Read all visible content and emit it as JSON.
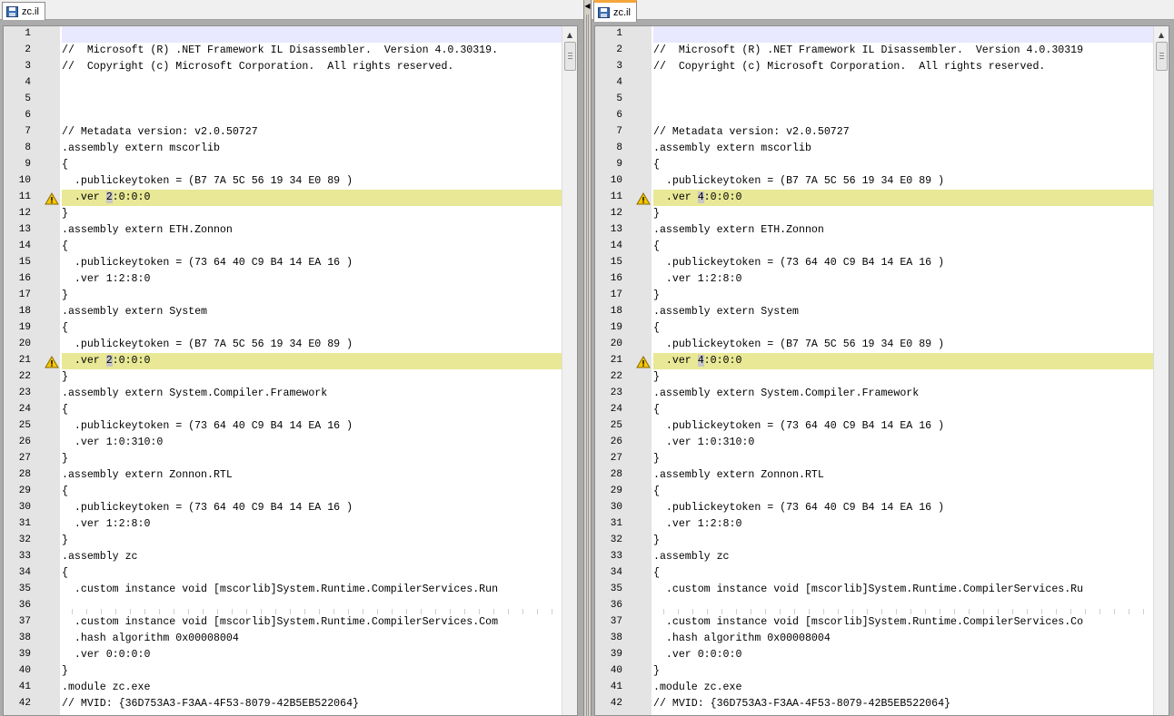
{
  "left": {
    "tab_label": "zc.il",
    "tab_icon": "save-disk-icon",
    "diff_char": "2",
    "lines": [
      {
        "n": "1",
        "text": "",
        "type": "current"
      },
      {
        "n": "2",
        "text": "//  Microsoft (R) .NET Framework IL Disassembler.  Version 4.0.30319.",
        "type": "normal"
      },
      {
        "n": "3",
        "text": "//  Copyright (c) Microsoft Corporation.  All rights reserved.",
        "type": "normal"
      },
      {
        "n": "4",
        "text": "",
        "type": "normal"
      },
      {
        "n": "5",
        "text": "",
        "type": "normal"
      },
      {
        "n": "6",
        "text": "",
        "type": "normal"
      },
      {
        "n": "7",
        "text": "// Metadata version: v2.0.50727",
        "type": "normal"
      },
      {
        "n": "8",
        "text": ".assembly extern mscorlib",
        "type": "normal"
      },
      {
        "n": "9",
        "text": "{",
        "type": "normal"
      },
      {
        "n": "10",
        "text": "  .publickeytoken = (B7 7A 5C 56 19 34 E0 89 )",
        "type": "normal"
      },
      {
        "n": "11",
        "pre": "  .ver ",
        "post": ":0:0:0",
        "type": "diff"
      },
      {
        "n": "12",
        "text": "}",
        "type": "normal"
      },
      {
        "n": "13",
        "text": ".assembly extern ETH.Zonnon",
        "type": "normal"
      },
      {
        "n": "14",
        "text": "{",
        "type": "normal"
      },
      {
        "n": "15",
        "text": "  .publickeytoken = (73 64 40 C9 B4 14 EA 16 )",
        "type": "normal"
      },
      {
        "n": "16",
        "text": "  .ver 1:2:8:0",
        "type": "normal"
      },
      {
        "n": "17",
        "text": "}",
        "type": "normal"
      },
      {
        "n": "18",
        "text": ".assembly extern System",
        "type": "normal"
      },
      {
        "n": "19",
        "text": "{",
        "type": "normal"
      },
      {
        "n": "20",
        "text": "  .publickeytoken = (B7 7A 5C 56 19 34 E0 89 )",
        "type": "normal"
      },
      {
        "n": "21",
        "pre": "  .ver ",
        "post": ":0:0:0",
        "type": "diff"
      },
      {
        "n": "22",
        "text": "}",
        "type": "normal"
      },
      {
        "n": "23",
        "text": ".assembly extern System.Compiler.Framework",
        "type": "normal"
      },
      {
        "n": "24",
        "text": "{",
        "type": "normal"
      },
      {
        "n": "25",
        "text": "  .publickeytoken = (73 64 40 C9 B4 14 EA 16 )",
        "type": "normal"
      },
      {
        "n": "26",
        "text": "  .ver 1:0:310:0",
        "type": "normal"
      },
      {
        "n": "27",
        "text": "}",
        "type": "normal"
      },
      {
        "n": "28",
        "text": ".assembly extern Zonnon.RTL",
        "type": "normal"
      },
      {
        "n": "29",
        "text": "{",
        "type": "normal"
      },
      {
        "n": "30",
        "text": "  .publickeytoken = (73 64 40 C9 B4 14 EA 16 )",
        "type": "normal"
      },
      {
        "n": "31",
        "text": "  .ver 1:2:8:0",
        "type": "normal"
      },
      {
        "n": "32",
        "text": "}",
        "type": "normal"
      },
      {
        "n": "33",
        "text": ".assembly zc",
        "type": "normal"
      },
      {
        "n": "34",
        "text": "{",
        "type": "normal"
      },
      {
        "n": "35",
        "text": "  .custom instance void [mscorlib]System.Runtime.CompilerServices.Run",
        "type": "normal"
      },
      {
        "n": "36",
        "text": "",
        "type": "dots"
      },
      {
        "n": "37",
        "text": "  .custom instance void [mscorlib]System.Runtime.CompilerServices.Com",
        "type": "normal"
      },
      {
        "n": "38",
        "text": "  .hash algorithm 0x00008004",
        "type": "normal"
      },
      {
        "n": "39",
        "text": "  .ver 0:0:0:0",
        "type": "normal"
      },
      {
        "n": "40",
        "text": "}",
        "type": "normal"
      },
      {
        "n": "41",
        "text": ".module zc.exe",
        "type": "normal"
      },
      {
        "n": "42",
        "text": "// MVID: {36D753A3-F3AA-4F53-8079-42B5EB522064}",
        "type": "normal"
      }
    ]
  },
  "right": {
    "tab_label": "zc.il",
    "tab_icon": "save-disk-icon",
    "diff_char": "4",
    "lines": [
      {
        "n": "1",
        "text": "",
        "type": "current"
      },
      {
        "n": "2",
        "text": "//  Microsoft (R) .NET Framework IL Disassembler.  Version 4.0.30319",
        "type": "normal"
      },
      {
        "n": "3",
        "text": "//  Copyright (c) Microsoft Corporation.  All rights reserved.",
        "type": "normal"
      },
      {
        "n": "4",
        "text": "",
        "type": "normal"
      },
      {
        "n": "5",
        "text": "",
        "type": "normal"
      },
      {
        "n": "6",
        "text": "",
        "type": "normal"
      },
      {
        "n": "7",
        "text": "// Metadata version: v2.0.50727",
        "type": "normal"
      },
      {
        "n": "8",
        "text": ".assembly extern mscorlib",
        "type": "normal"
      },
      {
        "n": "9",
        "text": "{",
        "type": "normal"
      },
      {
        "n": "10",
        "text": "  .publickeytoken = (B7 7A 5C 56 19 34 E0 89 )",
        "type": "normal"
      },
      {
        "n": "11",
        "pre": "  .ver ",
        "post": ":0:0:0",
        "type": "diff"
      },
      {
        "n": "12",
        "text": "}",
        "type": "normal"
      },
      {
        "n": "13",
        "text": ".assembly extern ETH.Zonnon",
        "type": "normal"
      },
      {
        "n": "14",
        "text": "{",
        "type": "normal"
      },
      {
        "n": "15",
        "text": "  .publickeytoken = (73 64 40 C9 B4 14 EA 16 )",
        "type": "normal"
      },
      {
        "n": "16",
        "text": "  .ver 1:2:8:0",
        "type": "normal"
      },
      {
        "n": "17",
        "text": "}",
        "type": "normal"
      },
      {
        "n": "18",
        "text": ".assembly extern System",
        "type": "normal"
      },
      {
        "n": "19",
        "text": "{",
        "type": "normal"
      },
      {
        "n": "20",
        "text": "  .publickeytoken = (B7 7A 5C 56 19 34 E0 89 )",
        "type": "normal"
      },
      {
        "n": "21",
        "pre": "  .ver ",
        "post": ":0:0:0",
        "type": "diff"
      },
      {
        "n": "22",
        "text": "}",
        "type": "normal"
      },
      {
        "n": "23",
        "text": ".assembly extern System.Compiler.Framework",
        "type": "normal"
      },
      {
        "n": "24",
        "text": "{",
        "type": "normal"
      },
      {
        "n": "25",
        "text": "  .publickeytoken = (73 64 40 C9 B4 14 EA 16 )",
        "type": "normal"
      },
      {
        "n": "26",
        "text": "  .ver 1:0:310:0",
        "type": "normal"
      },
      {
        "n": "27",
        "text": "}",
        "type": "normal"
      },
      {
        "n": "28",
        "text": ".assembly extern Zonnon.RTL",
        "type": "normal"
      },
      {
        "n": "29",
        "text": "{",
        "type": "normal"
      },
      {
        "n": "30",
        "text": "  .publickeytoken = (73 64 40 C9 B4 14 EA 16 )",
        "type": "normal"
      },
      {
        "n": "31",
        "text": "  .ver 1:2:8:0",
        "type": "normal"
      },
      {
        "n": "32",
        "text": "}",
        "type": "normal"
      },
      {
        "n": "33",
        "text": ".assembly zc",
        "type": "normal"
      },
      {
        "n": "34",
        "text": "{",
        "type": "normal"
      },
      {
        "n": "35",
        "text": "  .custom instance void [mscorlib]System.Runtime.CompilerServices.Ru",
        "type": "normal"
      },
      {
        "n": "36",
        "text": "",
        "type": "dots"
      },
      {
        "n": "37",
        "text": "  .custom instance void [mscorlib]System.Runtime.CompilerServices.Co",
        "type": "normal"
      },
      {
        "n": "38",
        "text": "  .hash algorithm 0x00008004",
        "type": "normal"
      },
      {
        "n": "39",
        "text": "  .ver 0:0:0:0",
        "type": "normal"
      },
      {
        "n": "40",
        "text": "}",
        "type": "normal"
      },
      {
        "n": "41",
        "text": ".module zc.exe",
        "type": "normal"
      },
      {
        "n": "42",
        "text": "// MVID: {36D753A3-F3AA-4F53-8079-42B5EB522064}",
        "type": "normal"
      }
    ]
  },
  "warning_icon": "warning-triangle-icon",
  "colors": {
    "diff_line": "#e8e896",
    "current_line": "#e8e8ff",
    "gutter": "#e4e4e4",
    "active_tab_accent": "#f5a63a"
  }
}
